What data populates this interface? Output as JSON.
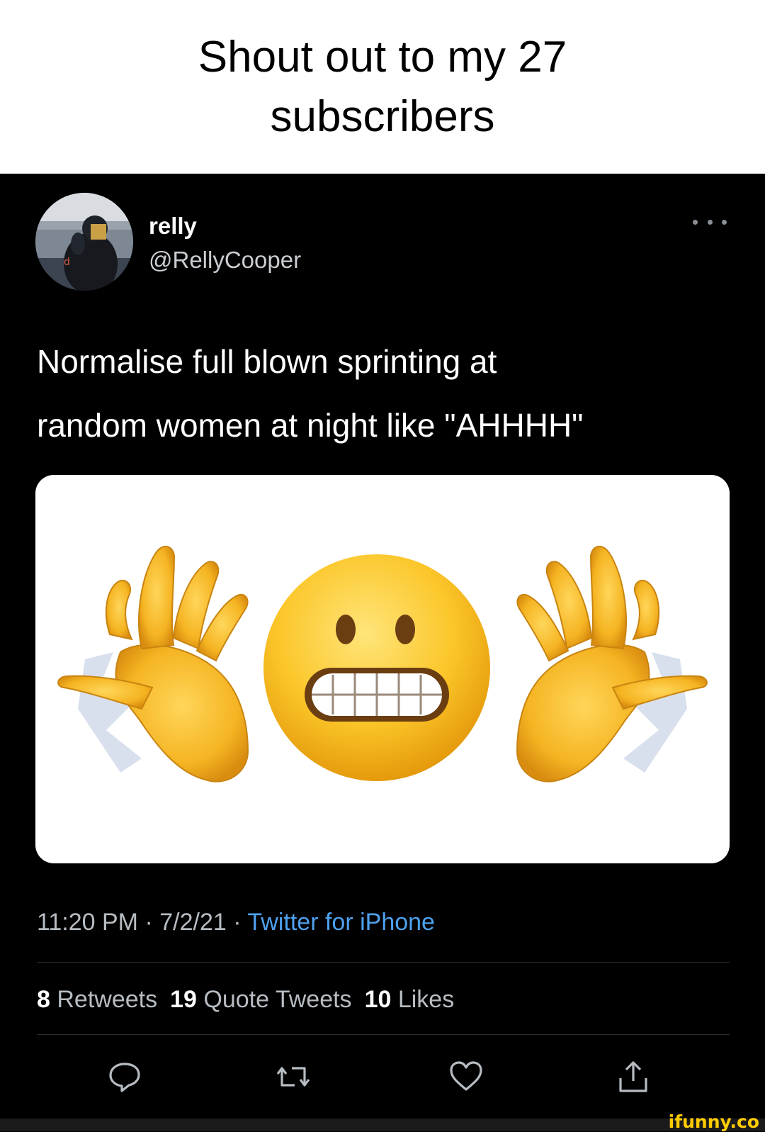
{
  "caption": {
    "line1": "Shout out to my 27",
    "line2": "subscribers"
  },
  "tweet": {
    "display_name": "relly",
    "handle": "@RellyCooper",
    "text_line1": "Normalise full blown sprinting at",
    "text_line2": "random women at night like \"AHHHH\"",
    "time": "11:20 PM",
    "date": "7/2/21",
    "source": "Twitter for iPhone",
    "stats": {
      "retweets_count": "8",
      "retweets_label": "Retweets",
      "quotes_count": "19",
      "quotes_label": "Quote Tweets",
      "likes_count": "10",
      "likes_label": "Likes"
    },
    "icons": {
      "more": "more-options-icon",
      "reply": "reply-icon",
      "retweet": "retweet-icon",
      "like": "heart-icon",
      "share": "share-icon"
    },
    "colors": {
      "link": "#4ea1ee",
      "secondary_text": "#b6bcc2",
      "background": "#000000"
    }
  },
  "watermark": "ifunny.co"
}
